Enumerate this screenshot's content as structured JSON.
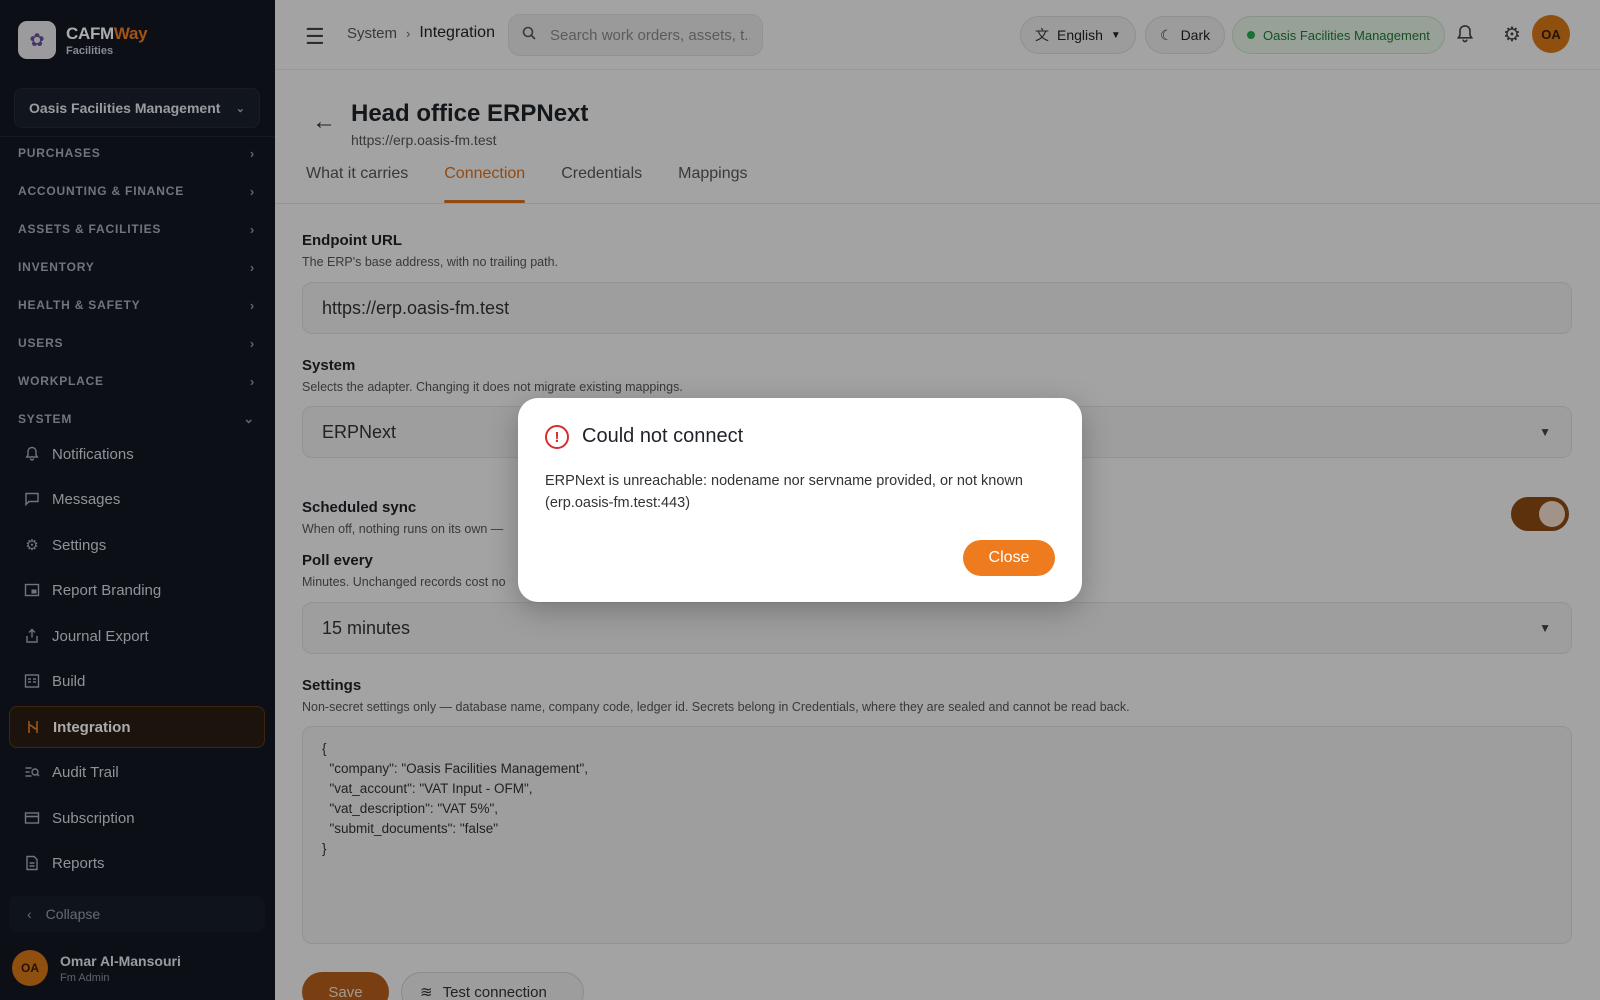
{
  "brand": {
    "name_main": "CAFM",
    "name_accent": "Way",
    "sub": "Facilities"
  },
  "sidebar": {
    "org": "Oasis Facilities Management",
    "sections": [
      {
        "label": "PURCHASES"
      },
      {
        "label": "ACCOUNTING & FINANCE"
      },
      {
        "label": "ASSETS & FACILITIES"
      },
      {
        "label": "INVENTORY"
      },
      {
        "label": "HEALTH & SAFETY"
      },
      {
        "label": "USERS"
      },
      {
        "label": "WORKPLACE"
      },
      {
        "label": "SYSTEM"
      }
    ],
    "items": [
      {
        "label": "Notifications",
        "icon": "bell-icon"
      },
      {
        "label": "Messages",
        "icon": "chat-icon"
      },
      {
        "label": "Settings",
        "icon": "gear-icon"
      },
      {
        "label": "Report Branding",
        "icon": "branding-icon"
      },
      {
        "label": "Journal Export",
        "icon": "export-icon"
      },
      {
        "label": "Build",
        "icon": "build-icon"
      },
      {
        "label": "Integration",
        "icon": "integration-icon",
        "active": true
      },
      {
        "label": "Audit Trail",
        "icon": "audit-icon"
      },
      {
        "label": "Subscription",
        "icon": "card-icon"
      },
      {
        "label": "Reports",
        "icon": "report-icon"
      }
    ],
    "collapse_label": "Collapse",
    "user": {
      "initials": "OA",
      "name": "Omar Al-Mansouri",
      "role": "Fm Admin"
    }
  },
  "topbar": {
    "breadcrumb": [
      "System",
      "Integration"
    ],
    "search_placeholder": "Search work orders, assets, t...",
    "language": "English",
    "theme": "Dark",
    "org_badge": "Oasis Facilities Management",
    "avatar_initials": "OA"
  },
  "page": {
    "title": "Head office ERPNext",
    "subtitle": "https://erp.oasis-fm.test",
    "tabs": [
      "What it carries",
      "Connection",
      "Credentials",
      "Mappings"
    ],
    "active_tab": "Connection"
  },
  "form": {
    "endpoint": {
      "label": "Endpoint URL",
      "help": "The ERP's base address, with no trailing path.",
      "value": "https://erp.oasis-fm.test"
    },
    "system": {
      "label": "System",
      "help": "Selects the adapter. Changing it does not migrate existing mappings.",
      "value": "ERPNext"
    },
    "scheduled_sync": {
      "label": "Scheduled sync",
      "help": "When off, nothing runs on its own —",
      "enabled": true
    },
    "poll": {
      "label": "Poll every",
      "help": "Minutes. Unchanged records cost no",
      "value": "15 minutes"
    },
    "settings": {
      "label": "Settings",
      "help": "Non-secret settings only — database name, company code, ledger id. Secrets belong in Credentials, where they are sealed and cannot be read back.",
      "value": "{\n  \"company\": \"Oasis Facilities Management\",\n  \"vat_account\": \"VAT Input - OFM\",\n  \"vat_description\": \"VAT 5%\",\n  \"submit_documents\": \"false\"\n}"
    },
    "save_label": "Save",
    "test_label": "Test connection"
  },
  "dialog": {
    "title": "Could not connect",
    "message": "ERPNext is unreachable: nodename nor servname provided, or not known (erp.oasis-fm.test:443)",
    "close_label": "Close"
  },
  "colors": {
    "accent": "#ef7d22",
    "sidebar_bg": "#121722",
    "error": "#d32f2f",
    "org_badge": "#1e7a35"
  }
}
